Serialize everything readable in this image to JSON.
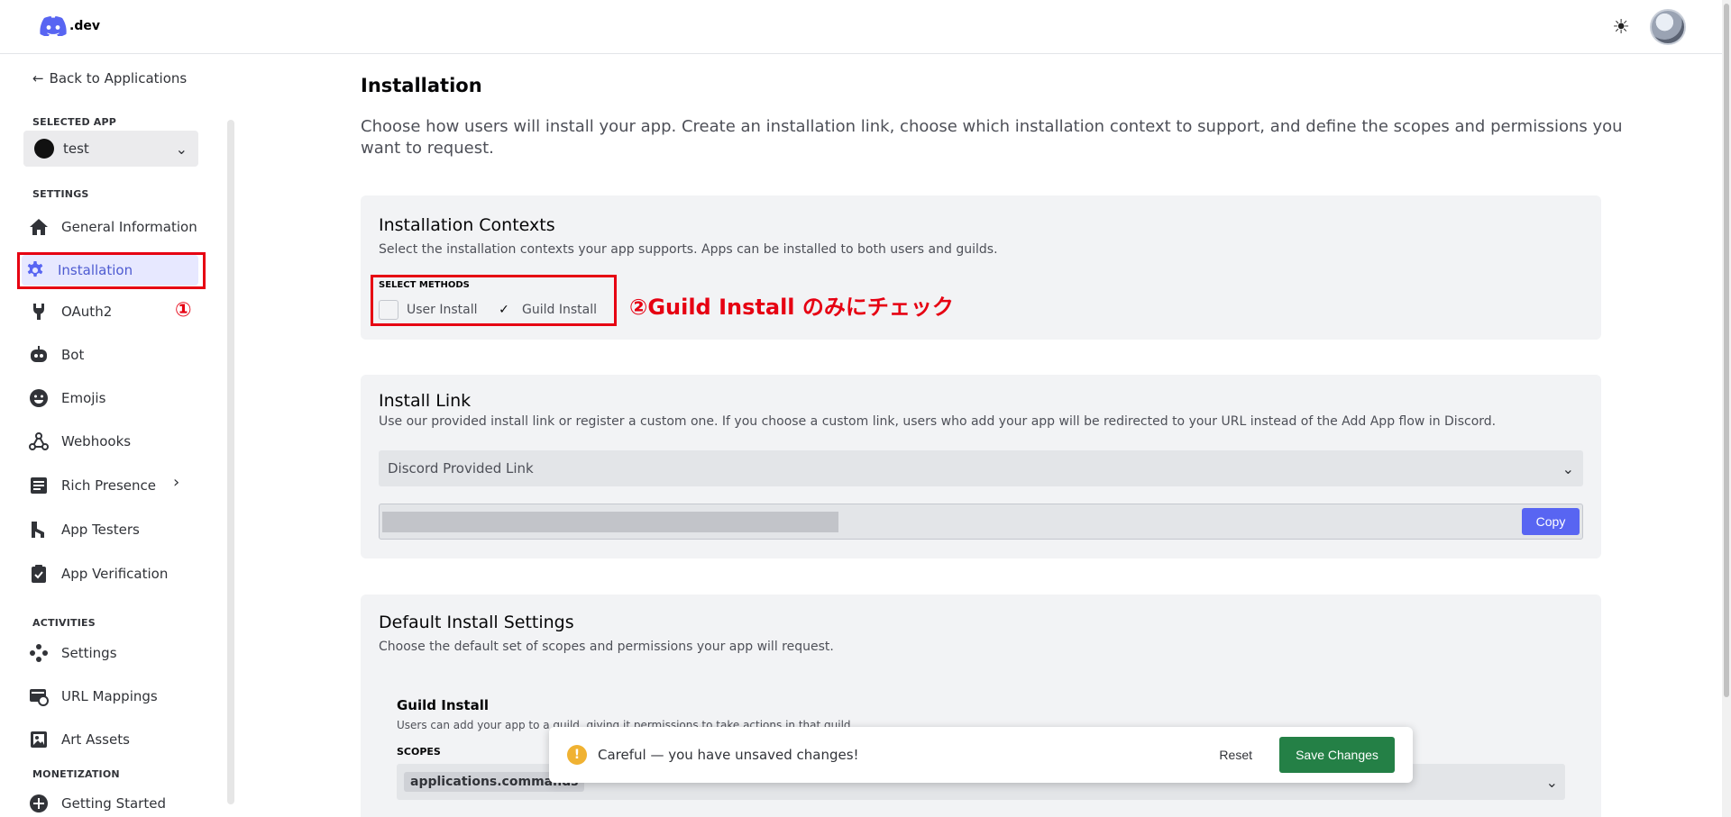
{
  "header": {
    "logo_text": ".dev",
    "theme_icon": "sun-icon",
    "avatar": "user-avatar"
  },
  "sidebar": {
    "back_label": "Back to Applications",
    "selected_app_label": "SELECTED APP",
    "selected_app_value": "test",
    "settings_label": "SETTINGS",
    "settings_items": [
      {
        "label": "General Information",
        "icon": "home-icon"
      },
      {
        "label": "Installation",
        "icon": "gear-icon"
      },
      {
        "label": "OAuth2",
        "icon": "wrench-icon"
      },
      {
        "label": "Bot",
        "icon": "bot-icon"
      },
      {
        "label": "Emojis",
        "icon": "emoji-icon"
      },
      {
        "label": "Webhooks",
        "icon": "webhook-icon"
      },
      {
        "label": "Rich Presence",
        "icon": "rich-presence-icon"
      },
      {
        "label": "App Testers",
        "icon": "testers-icon"
      },
      {
        "label": "App Verification",
        "icon": "clipboard-check-icon"
      }
    ],
    "activities_label": "ACTIVITIES",
    "activities_items": [
      {
        "label": "Settings",
        "icon": "gamepad-icon"
      },
      {
        "label": "URL Mappings",
        "icon": "url-mapping-icon"
      },
      {
        "label": "Art Assets",
        "icon": "image-icon"
      }
    ],
    "monetization_label": "MONETIZATION",
    "monetization_items": [
      {
        "label": "Getting Started",
        "icon": "plus-circle-icon"
      }
    ],
    "annotation": "①"
  },
  "main": {
    "title": "Installation",
    "description": "Choose how users will install your app. Create an installation link, choose which installation context to support, and define the scopes and permissions you want to request.",
    "contexts": {
      "title": "Installation Contexts",
      "description": "Select the installation contexts your app supports. Apps can be installed to both users and guilds.",
      "methods_label": "SELECT METHODS",
      "user_install_label": "User Install",
      "guild_install_label": "Guild Install",
      "check_mark": "✓",
      "annotation": "②Guild Install のみにチェック"
    },
    "install_link": {
      "title": "Install Link",
      "description": "Use our provided install link or register a custom one. If you choose a custom link, users who add your app will be redirected to your URL instead of the Add App flow in Discord.",
      "selected_option": "Discord Provided Link",
      "copy_label": "Copy"
    },
    "default_install": {
      "title": "Default Install Settings",
      "description": "Choose the default set of scopes and permissions your app will request.",
      "guild_install_title": "Guild Install",
      "guild_install_desc": "Users can add your app to a guild, giving it permissions to take actions in that guild.",
      "scopes_label": "SCOPES",
      "scope_tag": "applications.commands"
    }
  },
  "notice": {
    "text": "Careful — you have unsaved changes!",
    "warn_symbol": "!",
    "reset_label": "Reset",
    "save_label": "Save Changes"
  },
  "colors": {
    "accent": "#5865f2",
    "save_green": "#248046",
    "annotation_red": "#e60012",
    "warning": "#f0b232"
  }
}
